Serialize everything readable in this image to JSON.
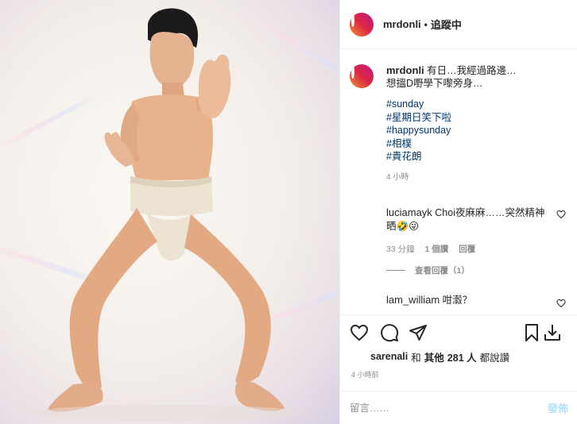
{
  "post": {
    "username": "mrdonli",
    "follow_label": "追蹤中",
    "separator": "•"
  },
  "caption": {
    "username": "mrdonli",
    "line1": "有日…我經過路邊…",
    "line2": "想搵D嘢學下嚟旁身…",
    "hashtags": [
      "#sunday",
      "#星期日笑下啦",
      "#happysunday",
      "#相樸",
      "#貴花朗"
    ],
    "time": "4 小時"
  },
  "comments": [
    {
      "username": "luciamayk",
      "text": "Choi夜麻麻……突然精神晒🤣😜",
      "time": "33 分鐘",
      "likes": "1 個讚",
      "reply": "回覆",
      "view_replies": "查看回覆（1）"
    },
    {
      "username": "lam_william",
      "text": "咁瀫？"
    }
  ],
  "actions": {
    "liked_by": "sarenali",
    "and": "和",
    "others_label": "其他",
    "others_count": "281 人",
    "said_like": "都說讚",
    "posted_time": "4 小時前"
  },
  "add_comment": {
    "placeholder": "留言……",
    "post_label": "發佈"
  },
  "icons": {
    "like": "heart-icon",
    "comment": "comment-bubble-icon",
    "share": "paper-plane-icon",
    "save": "bookmark-icon",
    "download": "download-icon",
    "comment_like": "heart-icon"
  },
  "colors": {
    "text": "#262626",
    "muted": "#8e8e8e",
    "hashtag": "#00376b",
    "post_button": "#b2dffc",
    "border": "#efefef"
  }
}
